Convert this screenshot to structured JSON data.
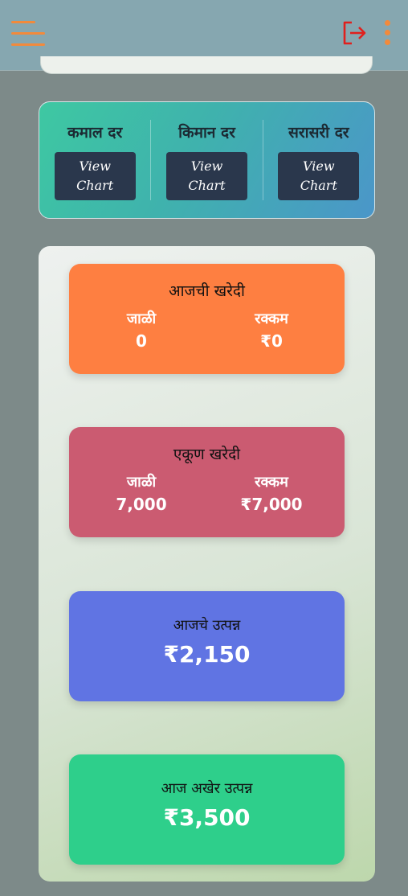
{
  "header": {
    "menu_icon": "hamburger-icon",
    "logout_icon": "logout-icon",
    "more_icon": "more-vert-icon",
    "accent_color": "#f28a3c",
    "logout_color": "#e0201d"
  },
  "rates": [
    {
      "title": "कमाल दर",
      "button_label": "View\nChart"
    },
    {
      "title": "किमान दर",
      "button_label": "View\nChart"
    },
    {
      "title": "सरासरी दर",
      "button_label": "View\nChart"
    }
  ],
  "today_purchase": {
    "title": "आजची खरेदी",
    "left_label": "जाळी",
    "left_value": "0",
    "right_label": "रक्कम",
    "right_value": "₹0"
  },
  "total_purchase": {
    "title": "एकूण खरेदी",
    "left_label": "जाळी",
    "left_value": "7,000",
    "right_label": "रक्कम",
    "right_value": "₹7,000"
  },
  "today_income": {
    "title": "आजचे उत्पन्न",
    "value": "₹2,150"
  },
  "total_income": {
    "title": "आज अखेर उत्पन्न",
    "value": "₹3,500"
  }
}
